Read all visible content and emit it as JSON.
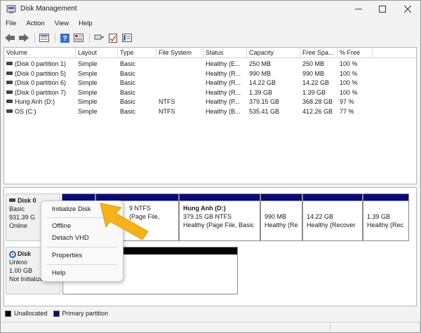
{
  "window": {
    "title": "Disk Management"
  },
  "menu": [
    "File",
    "Action",
    "View",
    "Help"
  ],
  "toolbar": {
    "icons": [
      "back-arrow-icon",
      "forward-arrow-icon",
      "disk-list-icon",
      "help-icon",
      "properties-icon",
      "connect-icon",
      "check-icon",
      "settings-panel-icon"
    ]
  },
  "volumes": {
    "columns": [
      "Volume",
      "Layout",
      "Type",
      "File System",
      "Status",
      "Capacity",
      "Free Spa...",
      "% Free"
    ],
    "rows": [
      [
        "(Disk 0 partition 1)",
        "Simple",
        "Basic",
        "",
        "Healthy (E...",
        "250 MB",
        "250 MB",
        "100 %"
      ],
      [
        "(Disk 0 partition 5)",
        "Simple",
        "Basic",
        "",
        "Healthy (R...",
        "990 MB",
        "990 MB",
        "100 %"
      ],
      [
        "(Disk 0 partition 6)",
        "Simple",
        "Basic",
        "",
        "Healthy (R...",
        "14.22 GB",
        "14.22 GB",
        "100 %"
      ],
      [
        "(Disk 0 partition 7)",
        "Simple",
        "Basic",
        "",
        "Healthy (R...",
        "1.39 GB",
        "1.39 GB",
        "100 %"
      ],
      [
        "Hung Anh (D:)",
        "Simple",
        "Basic",
        "NTFS",
        "Healthy (P...",
        "379.15 GB",
        "368.28 GB",
        "97 %"
      ],
      [
        "OS (C:)",
        "Simple",
        "Basic",
        "NTFS",
        "Healthy (B...",
        "535.41 GB",
        "412.26 GB",
        "77 %"
      ]
    ]
  },
  "disk0": {
    "name": "Disk 0",
    "type": "Basic",
    "size": "931.39 G",
    "state": "Online",
    "partitions": [
      {
        "lines": [
          "",
          ""
        ]
      },
      {
        "lines": [
          "9 NTFS",
          "(Page File,"
        ]
      },
      {
        "name": "Hung Anh  (D:)",
        "lines": [
          "379.15 GB NTFS",
          "Healthy (Page File, Basic"
        ]
      },
      {
        "lines": [
          "990 MB",
          "Healthy (Re"
        ]
      },
      {
        "lines": [
          "14.22 GB",
          "Healthy (Recover"
        ]
      },
      {
        "lines": [
          "1.39 GB",
          "Healthy (Rec"
        ]
      }
    ]
  },
  "disk1": {
    "name": "Disk",
    "type": "Unkno",
    "size": "1.00 GB",
    "state": "Not Initialized",
    "unallocated": "Unallocated"
  },
  "context_menu": {
    "items": [
      "Initialize Disk",
      "Offline",
      "Detach VHD",
      "Properties",
      "Help"
    ]
  },
  "legend": {
    "items": [
      {
        "label": "Unallocated",
        "color": "#000000"
      },
      {
        "label": "Primary partition",
        "color": "#0a0a7a"
      }
    ]
  },
  "colors": {
    "partition_bar": "#0a0a7a",
    "arrow": "#f5b21a"
  }
}
